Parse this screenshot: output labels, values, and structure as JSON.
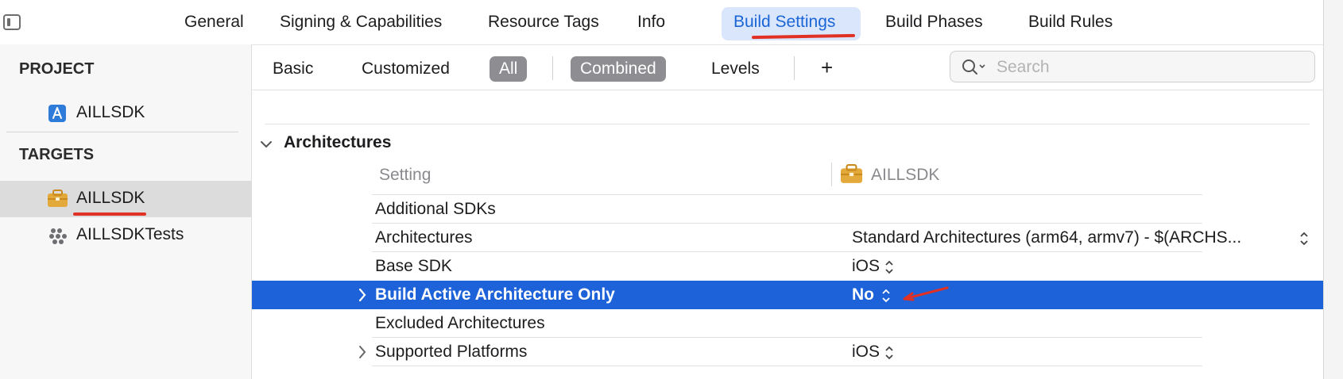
{
  "top_tabs": [
    "General",
    "Signing & Capabilities",
    "Resource Tags",
    "Info",
    "Build Settings",
    "Build Phases",
    "Build Rules"
  ],
  "active_tab": "Build Settings",
  "sidebar": {
    "project_header": "PROJECT",
    "project_item": "AILLSDK",
    "targets_header": "TARGETS",
    "targets": [
      {
        "label": "AILLSDK",
        "selected": true
      },
      {
        "label": "AILLSDKTests",
        "selected": false
      }
    ]
  },
  "filter": {
    "basic": "Basic",
    "customized": "Customized",
    "all": "All",
    "combined": "Combined",
    "levels": "Levels",
    "add": "+",
    "search_placeholder": "Search"
  },
  "section": {
    "title": "Architectures",
    "setting_header": "Setting",
    "target_header": "AILLSDK"
  },
  "rows": [
    {
      "label": "Additional SDKs",
      "value": ""
    },
    {
      "label": "Architectures",
      "value": "Standard Architectures (arm64, armv7)  -  $(ARCHS..."
    },
    {
      "label": "Base SDK",
      "value": "iOS"
    },
    {
      "label": "Build Active Architecture Only",
      "value": "No"
    },
    {
      "label": "Excluded Architectures",
      "value": ""
    },
    {
      "label": "Supported Platforms",
      "value": "iOS"
    }
  ],
  "colors": {
    "accent": "#1a66d6",
    "selection": "#1d62d9",
    "annotation": "#e03124",
    "target_icon": "#e3a93a",
    "project_icon": "#2f7bd9"
  }
}
